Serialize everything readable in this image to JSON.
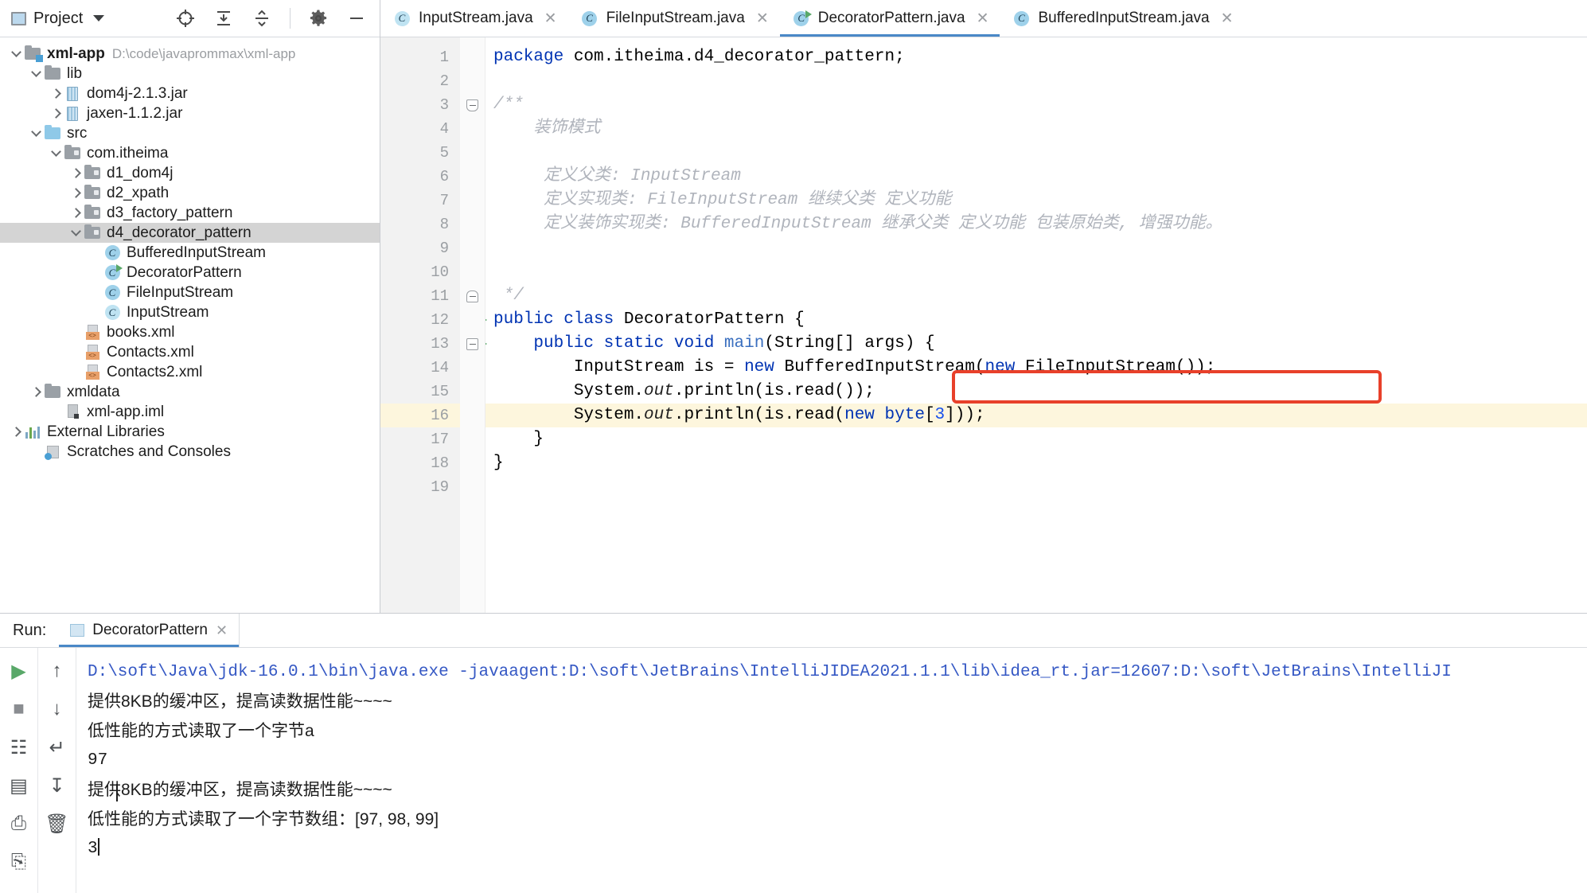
{
  "sidebar": {
    "title": "Project",
    "title_icon": "project-window-icon",
    "tools": [
      {
        "name": "locate-icon",
        "glyph": "⊕"
      },
      {
        "name": "expand-all-icon",
        "glyph": "⤓"
      },
      {
        "name": "collapse-all-icon",
        "glyph": "⤒"
      },
      {
        "name": "gear-icon",
        "glyph": "⚙"
      },
      {
        "name": "hide-icon",
        "glyph": "—"
      }
    ],
    "tree": [
      {
        "label": "xml-app",
        "path": "D:\\code\\javaprommax\\xml-app",
        "icon": "project-folder-icon",
        "arrow": "down",
        "indent": 0,
        "bold": true,
        "selected": false
      },
      {
        "label": "lib",
        "path": "",
        "icon": "folder-icon",
        "arrow": "down",
        "indent": 1,
        "bold": false,
        "selected": false
      },
      {
        "label": "dom4j-2.1.3.jar",
        "path": "",
        "icon": "jar-icon",
        "arrow": "right",
        "indent": 2,
        "bold": false,
        "selected": false
      },
      {
        "label": "jaxen-1.1.2.jar",
        "path": "",
        "icon": "jar-icon",
        "arrow": "right",
        "indent": 2,
        "bold": false,
        "selected": false
      },
      {
        "label": "src",
        "path": "",
        "icon": "source-folder-icon",
        "arrow": "down",
        "indent": 1,
        "bold": false,
        "selected": false
      },
      {
        "label": "com.itheima",
        "path": "",
        "icon": "package-icon",
        "arrow": "down",
        "indent": 2,
        "bold": false,
        "selected": false
      },
      {
        "label": "d1_dom4j",
        "path": "",
        "icon": "package-icon",
        "arrow": "right",
        "indent": 3,
        "bold": false,
        "selected": false
      },
      {
        "label": "d2_xpath",
        "path": "",
        "icon": "package-icon",
        "arrow": "right",
        "indent": 3,
        "bold": false,
        "selected": false
      },
      {
        "label": "d3_factory_pattern",
        "path": "",
        "icon": "package-icon",
        "arrow": "right",
        "indent": 3,
        "bold": false,
        "selected": false
      },
      {
        "label": "d4_decorator_pattern",
        "path": "",
        "icon": "package-icon",
        "arrow": "down",
        "indent": 3,
        "bold": false,
        "selected": true
      },
      {
        "label": "BufferedInputStream",
        "path": "",
        "icon": "java-class-icon",
        "arrow": "none",
        "indent": 4,
        "bold": false,
        "selected": false
      },
      {
        "label": "DecoratorPattern",
        "path": "",
        "icon": "java-runnable-class-icon",
        "arrow": "none",
        "indent": 4,
        "bold": false,
        "selected": false
      },
      {
        "label": "FileInputStream",
        "path": "",
        "icon": "java-class-icon",
        "arrow": "none",
        "indent": 4,
        "bold": false,
        "selected": false
      },
      {
        "label": "InputStream",
        "path": "",
        "icon": "java-abstract-class-icon",
        "arrow": "none",
        "indent": 4,
        "bold": false,
        "selected": false
      },
      {
        "label": "books.xml",
        "path": "",
        "icon": "xml-file-icon",
        "arrow": "none",
        "indent": 3,
        "bold": false,
        "selected": false
      },
      {
        "label": "Contacts.xml",
        "path": "",
        "icon": "xml-file-icon",
        "arrow": "none",
        "indent": 3,
        "bold": false,
        "selected": false
      },
      {
        "label": "Contacts2.xml",
        "path": "",
        "icon": "xml-file-icon",
        "arrow": "none",
        "indent": 3,
        "bold": false,
        "selected": false
      },
      {
        "label": "xmldata",
        "path": "",
        "icon": "folder-icon",
        "arrow": "right",
        "indent": 1,
        "bold": false,
        "selected": false
      },
      {
        "label": "xml-app.iml",
        "path": "",
        "icon": "iml-file-icon",
        "arrow": "none",
        "indent": 2,
        "bold": false,
        "selected": false
      },
      {
        "label": "External Libraries",
        "path": "",
        "icon": "external-libraries-icon",
        "arrow": "right",
        "indent": 0,
        "bold": false,
        "selected": false
      },
      {
        "label": "Scratches and Consoles",
        "path": "",
        "icon": "scratches-icon",
        "arrow": "none",
        "indent": 1,
        "bold": false,
        "selected": false
      }
    ]
  },
  "editor": {
    "tabs": [
      {
        "label": "InputStream.java",
        "icon": "java-abstract-class-icon",
        "active": false,
        "closable": true
      },
      {
        "label": "FileInputStream.java",
        "icon": "java-class-icon",
        "active": false,
        "closable": true
      },
      {
        "label": "DecoratorPattern.java",
        "icon": "java-runnable-class-icon",
        "active": true,
        "closable": true
      },
      {
        "label": "BufferedInputStream.java",
        "icon": "java-class-icon",
        "active": false,
        "closable": true
      }
    ],
    "line_numbers": [
      "1",
      "2",
      "3",
      "4",
      "5",
      "6",
      "7",
      "8",
      "9",
      "10",
      "11",
      "12",
      "13",
      "14",
      "15",
      "16",
      "17",
      "18",
      "19"
    ],
    "current_line": "16",
    "lines": [
      {
        "n": "1",
        "text": "package com.itheima.d4_decorator_pattern;"
      },
      {
        "n": "2",
        "text": ""
      },
      {
        "n": "3",
        "text": "/**"
      },
      {
        "n": "4",
        "text": "    装饰模式"
      },
      {
        "n": "5",
        "text": ""
      },
      {
        "n": "6",
        "text": "     定义父类: InputStream"
      },
      {
        "n": "7",
        "text": "     定义实现类: FileInputStream 继续父类 定义功能"
      },
      {
        "n": "8",
        "text": "     定义装饰实现类: BufferedInputStream 继承父类 定义功能 包装原始类, 增强功能。"
      },
      {
        "n": "9",
        "text": ""
      },
      {
        "n": "10",
        "text": ""
      },
      {
        "n": "11",
        "text": " */"
      },
      {
        "n": "12",
        "text": "public class DecoratorPattern {"
      },
      {
        "n": "13",
        "text": "    public static void main(String[] args) {"
      },
      {
        "n": "14",
        "text": "        InputStream is = new BufferedInputStream(new FileInputStream());"
      },
      {
        "n": "15",
        "text": "        System.out.println(is.read());"
      },
      {
        "n": "16",
        "text": "        System.out.println(is.read(new byte[3]));"
      },
      {
        "n": "17",
        "text": "    }"
      },
      {
        "n": "18",
        "text": "}"
      },
      {
        "n": "19",
        "text": ""
      }
    ],
    "highlight_box": {
      "name": "red-annotation-box",
      "color": "#e8402a"
    }
  },
  "run_panel": {
    "label": "Run:",
    "tab_label": "DecoratorPattern",
    "left_buttons": [
      {
        "name": "rerun-icon",
        "glyph": "▶"
      },
      {
        "name": "stop-icon",
        "glyph": "■"
      },
      {
        "name": "debug-rerun-icon",
        "glyph": "☷"
      },
      {
        "name": "layout-icon",
        "glyph": "▤"
      },
      {
        "name": "print-icon",
        "glyph": "⎙"
      },
      {
        "name": "pin-icon",
        "glyph": "⎘"
      }
    ],
    "right_buttons": [
      {
        "name": "scroll-up-icon",
        "glyph": "↑"
      },
      {
        "name": "scroll-down-icon",
        "glyph": "↓"
      },
      {
        "name": "soft-wrap-icon",
        "glyph": "↵"
      },
      {
        "name": "scroll-to-end-icon",
        "glyph": "↧"
      },
      {
        "name": "clear-all-icon",
        "glyph": "🗑"
      }
    ],
    "console": [
      {
        "text": "D:\\soft\\Java\\jdk-16.0.1\\bin\\java.exe -javaagent:D:\\soft\\JetBrains\\IntelliJIDEA2021.1.1\\lib\\idea_rt.jar=12607:D:\\soft\\JetBrains\\IntelliJI",
        "style": "command"
      },
      {
        "text": "提供8KB的缓冲区，提高读数据性能~~~~",
        "style": "plain"
      },
      {
        "text": "低性能的方式读取了一个字节a",
        "style": "plain"
      },
      {
        "text": "97",
        "style": "mono"
      },
      {
        "text": "提供8KB的缓冲区，提高读数据性能~~~~",
        "style": "plain"
      },
      {
        "text": "低性能的方式读取了一个字节数组：[97, 98, 99]",
        "style": "plain"
      },
      {
        "text": "3",
        "style": "mono"
      }
    ]
  },
  "colors": {
    "accent": "#4a88c7",
    "keyword": "#0033b3",
    "comment": "#b0b4bc",
    "annotation": "#e8402a",
    "selection": "#d4d4d4",
    "current_line": "#fdf6dd"
  }
}
